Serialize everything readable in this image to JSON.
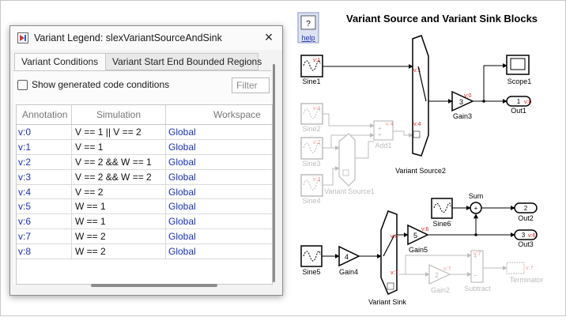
{
  "dialog": {
    "title": "Variant Legend: slexVariantSourceAndSink",
    "tabs": [
      {
        "label": "Variant Conditions",
        "active": true
      },
      {
        "label": "Variant Start End Bounded Regions",
        "active": false
      }
    ],
    "checkbox_label": "Show generated code conditions",
    "checkbox_checked": false,
    "filter_placeholder": "Filter",
    "columns": [
      "Annotation",
      "Simulation",
      "Workspace"
    ],
    "rows": [
      {
        "annotation": "v:0",
        "simulation": "V == 1 || V == 2",
        "workspace": "Global"
      },
      {
        "annotation": "v:1",
        "simulation": "V == 1",
        "workspace": "Global"
      },
      {
        "annotation": "v:2",
        "simulation": "V == 2 && W == 1",
        "workspace": "Global"
      },
      {
        "annotation": "v:3",
        "simulation": "V == 2 && W == 2",
        "workspace": "Global"
      },
      {
        "annotation": "v:4",
        "simulation": "V == 2",
        "workspace": "Global"
      },
      {
        "annotation": "v:5",
        "simulation": "W == 1",
        "workspace": "Global"
      },
      {
        "annotation": "v:6",
        "simulation": "W == 1",
        "workspace": "Global"
      },
      {
        "annotation": "v:7",
        "simulation": "W == 2",
        "workspace": "Global"
      },
      {
        "annotation": "v:8",
        "simulation": "W == 2",
        "workspace": "Global"
      }
    ]
  },
  "model": {
    "title": "Variant Source and Variant Sink Blocks",
    "help_label": "help",
    "help_symbol": "?",
    "blocks": {
      "sine1": "Sine1",
      "sine2": "Sine2",
      "sine3": "Sine3",
      "sine4": "Sine4",
      "sine5": "Sine5",
      "sine6": "Sine6",
      "add1": "Add1",
      "variant_source1": "Variant Source1",
      "variant_source2": "Variant Source2",
      "gain3": "Gain3",
      "gain3_value": "3",
      "scope1": "Scope1",
      "out1": "Out1",
      "out1_port": "1",
      "gain4": "Gain4",
      "gain4_value": "4",
      "variant_sink": "Variant Sink",
      "gain5": "Gain5",
      "gain5_value": "5",
      "gain2": "Gain2",
      "gain2_value": "2",
      "sum": "Sum",
      "out2": "Out2",
      "out2_port": "2",
      "out3": "Out3",
      "out3_port": "3",
      "subtract": "Subtract",
      "terminator": "Terminator"
    },
    "annotations": {
      "sine1": "v:1",
      "sine2": "v:4",
      "sine3": "v:2",
      "sine4": "v:3",
      "add1": "v:4",
      "vs2_in1": "v:1",
      "vs2_in2": "v:4",
      "gain3": "v:0",
      "out1": "v:0",
      "vsink_out1": "v:6",
      "vsink_out2": "v:7",
      "gain5": "v:6",
      "out3": "v:6",
      "gain2": "v:7",
      "subtract": "v:7",
      "terminator": "v:7"
    },
    "colors": {
      "annotation": "#d92020",
      "active_line": "#000000",
      "inactive": "#bdbdbd",
      "link": "#1a32b0"
    }
  }
}
